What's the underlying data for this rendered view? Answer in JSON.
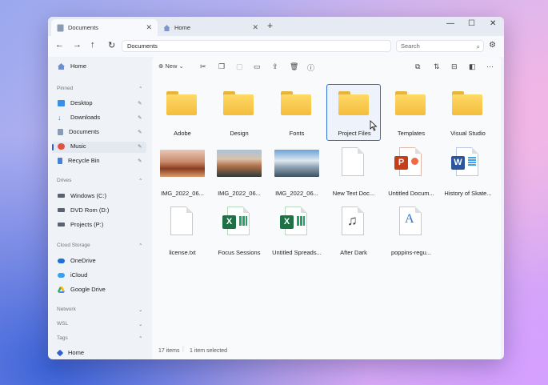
{
  "tabs": [
    {
      "label": "Documents",
      "active": true
    },
    {
      "label": "Home",
      "active": false
    }
  ],
  "window_controls": {
    "minimize": "—",
    "maximize": "☐",
    "close": "✕"
  },
  "nav": {
    "back": "←",
    "forward": "→",
    "up": "↑",
    "refresh": "↻"
  },
  "address": "Documents",
  "search_placeholder": "Search",
  "toolbar": {
    "new_label": "New"
  },
  "sidebar": {
    "home": "Home",
    "pinned_header": "Pinned",
    "pinned": [
      {
        "label": "Desktop",
        "color": "#3a8ee6"
      },
      {
        "label": "Downloads",
        "color": "#2c7be5"
      },
      {
        "label": "Documents",
        "color": "#8b9bb4"
      },
      {
        "label": "Music",
        "color": "#e0523f"
      },
      {
        "label": "Recycle Bin",
        "color": "#4a7fd1"
      }
    ],
    "drives_header": "Drives",
    "drives": [
      {
        "label": "Windows (C:)"
      },
      {
        "label": "DVD Rom (D:)"
      },
      {
        "label": "Projects (P:)"
      }
    ],
    "cloud_header": "Cloud Storage",
    "cloud": [
      {
        "label": "OneDrive",
        "color": "#1e6fd9"
      },
      {
        "label": "iCloud",
        "color": "#3aa0f0"
      },
      {
        "label": "Google Drive",
        "color": "#34a853"
      }
    ],
    "network_header": "Network",
    "wsl_header": "WSL",
    "tags_header": "Tags",
    "tags_home": "Home"
  },
  "files": [
    {
      "label": "Adobe",
      "kind": "folder"
    },
    {
      "label": "Design",
      "kind": "folder"
    },
    {
      "label": "Fonts",
      "kind": "folder"
    },
    {
      "label": "Project Files",
      "kind": "folder",
      "selected": true
    },
    {
      "label": "Templates",
      "kind": "folder"
    },
    {
      "label": "Visual Studio",
      "kind": "folder"
    },
    {
      "label": "IMG_2022_06...",
      "kind": "image-desert"
    },
    {
      "label": "IMG_2022_06...",
      "kind": "image-mountain"
    },
    {
      "label": "IMG_2022_06...",
      "kind": "image-snow"
    },
    {
      "label": "New Text Doc...",
      "kind": "text"
    },
    {
      "label": "Untitled Docum...",
      "kind": "powerpoint"
    },
    {
      "label": "History of Skate...",
      "kind": "word"
    },
    {
      "label": "license.txt",
      "kind": "text"
    },
    {
      "label": "Focus Sessions",
      "kind": "excel"
    },
    {
      "label": "Untitled Spreads...",
      "kind": "excel"
    },
    {
      "label": "After Dark",
      "kind": "music"
    },
    {
      "label": "poppins-regu...",
      "kind": "font"
    }
  ],
  "status": {
    "count": "17 items",
    "selection": "1 item selected"
  }
}
